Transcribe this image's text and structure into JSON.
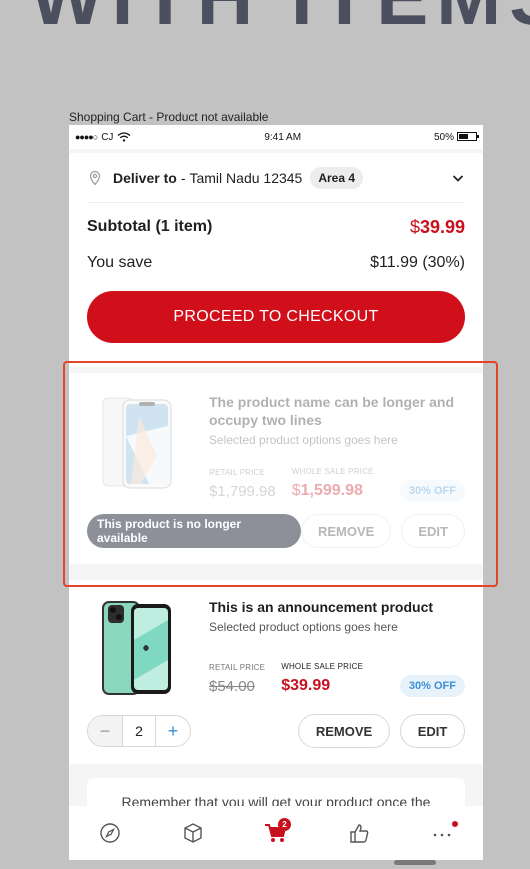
{
  "background": {
    "heading_fragment": "WITH ITEMS L"
  },
  "artboard_label": "Shopping Cart - Product not available",
  "statusbar": {
    "signal": "●●●●○",
    "carrier": "CJ",
    "time": "9:41 AM",
    "battery": "50%"
  },
  "delivery": {
    "label": "Deliver to",
    "separator": "-",
    "location": "Tamil Nadu 12345",
    "area": "Area 4"
  },
  "summary": {
    "subtotal_label": "Subtotal (1 item)",
    "subtotal_currency": "$",
    "subtotal_value": "39.99",
    "save_label": "You save",
    "save_value": "$11.99 (30%)",
    "checkout_label": "PROCEED TO CHECKOUT"
  },
  "items": [
    {
      "name": "The product name can be longer and occupy two lines",
      "options": "Selected product options goes here",
      "retail_label": "RETAIL PRICE",
      "retail_price": "$1,799.98",
      "wholesale_label": "WHOLE SALE PRICE",
      "wholesale_currency": "$",
      "wholesale_price": "1,599.98",
      "discount": "30% OFF",
      "status": "This product is no longer available",
      "remove_label": "REMOVE",
      "edit_label": "EDIT",
      "available": false
    },
    {
      "name": "This is an announcement product",
      "options": "Selected product options goes here",
      "retail_label": "RETAIL PRICE",
      "retail_price": "$54.00",
      "wholesale_label": "WHOLE SALE PRICE",
      "wholesale_price": "$39.99",
      "discount": "30% OFF",
      "quantity": "2",
      "remove_label": "REMOVE",
      "edit_label": "EDIT",
      "available": true
    }
  ],
  "notice": "Remember that you will get your product once the",
  "tabbar": {
    "tabs": [
      {
        "icon": "compass-icon"
      },
      {
        "icon": "box-icon"
      },
      {
        "icon": "cart-icon",
        "badge": "2",
        "active": true
      },
      {
        "icon": "thumbs-up-icon"
      },
      {
        "icon": "more-icon",
        "dot": true
      }
    ]
  },
  "colors": {
    "accent": "#d10f1b",
    "discount_blue": "#3a8fd6",
    "selection": "#e2452a"
  }
}
